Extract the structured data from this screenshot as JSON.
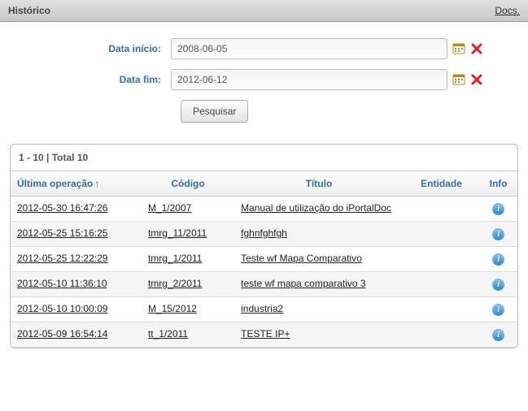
{
  "header": {
    "title": "Histórico",
    "docs": "Docs."
  },
  "form": {
    "start_label": "Data início:",
    "end_label": "Data fim:",
    "start_value": "2008-06-05",
    "end_value": "2012-06-12",
    "search_label": "Pesquisar"
  },
  "summary": "1 - 10 | Total 10",
  "columns": {
    "op": "Última operação",
    "code": "Código",
    "title": "Título",
    "entity": "Entidade",
    "info": "Info"
  },
  "rows": [
    {
      "op": "2012-05-30 16:47:26",
      "code": "M_1/2007",
      "title": "Manual de utilização do iPortalDoc",
      "entity": ""
    },
    {
      "op": "2012-05-25 15:16:25",
      "code": "tmrg_11/2011",
      "title": "fghnfghfgh",
      "entity": ""
    },
    {
      "op": "2012-05-25 12:22:29",
      "code": "tmrg_1/2011",
      "title": "Teste wf Mapa Comparativo",
      "entity": ""
    },
    {
      "op": "2012-05-10 11:36:10",
      "code": "tmrg_2/2011",
      "title": "teste wf mapa comparativo 3",
      "entity": ""
    },
    {
      "op": "2012-05-10 10:00:09",
      "code": "M_15/2012",
      "title": "industria2",
      "entity": ""
    },
    {
      "op": "2012-05-09 16:54:14",
      "code": "tt_1/2011",
      "title": "TESTE IP+",
      "entity": ""
    }
  ]
}
